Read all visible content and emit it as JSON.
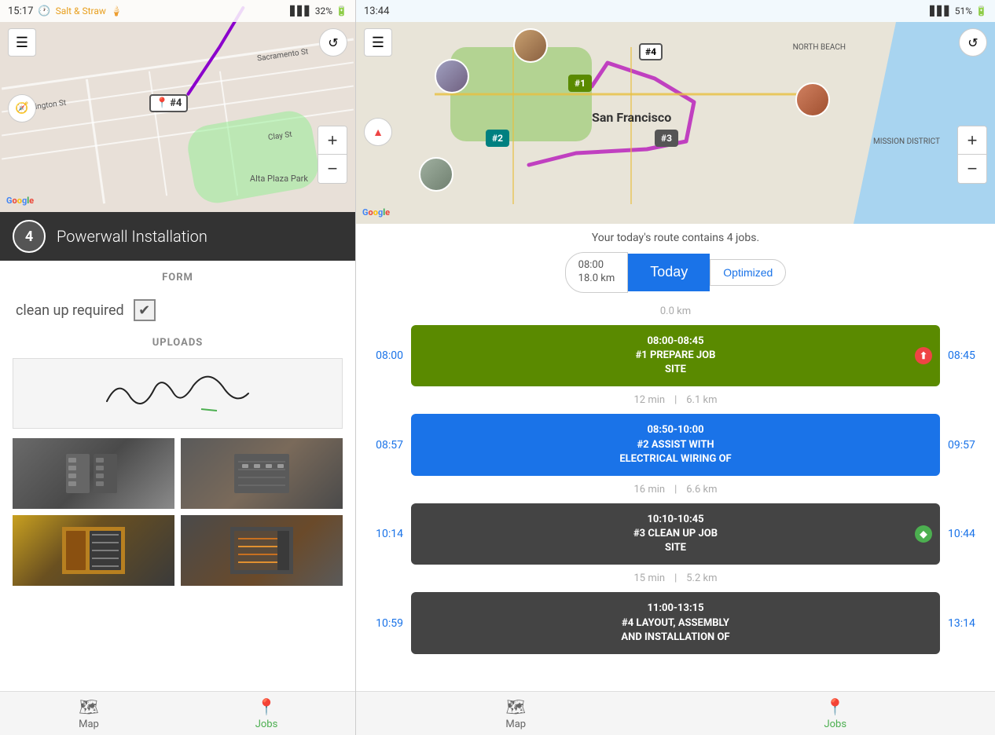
{
  "left": {
    "statusBar": {
      "time": "15:17",
      "battery": "32%",
      "appName": "Salt & Straw"
    },
    "map": {
      "parkName": "Alta Plaza Park",
      "streetNames": [
        "Sacramento St",
        "Washington St",
        "Clay St"
      ],
      "pinNumber": "#4",
      "googleLogo": [
        "G",
        "o",
        "o",
        "g",
        "l",
        "e"
      ]
    },
    "jobBar": {
      "number": "4",
      "title": "Powerwall Installation"
    },
    "formLabel": "FORM",
    "checkboxRow": {
      "label": "clean up required",
      "checked": true
    },
    "uploadsLabel": "UPLOADS",
    "signatureText": "James Miller",
    "bottomNav": {
      "map": {
        "label": "Map",
        "active": false
      },
      "jobs": {
        "label": "Jobs",
        "active": true
      }
    }
  },
  "right": {
    "statusBar": {
      "time": "13:44",
      "battery": "51%"
    },
    "map": {
      "city": "San Francisco",
      "district1": "NORTH BEACH",
      "district2": "MISSION DISTRICT",
      "googleLogo": [
        "G",
        "o",
        "o",
        "g",
        "l",
        "e"
      ],
      "pins": [
        {
          "id": "#1",
          "type": "green"
        },
        {
          "id": "#2",
          "type": "teal"
        },
        {
          "id": "#3",
          "type": "gray"
        },
        {
          "id": "#4",
          "type": "white"
        }
      ]
    },
    "routeInfo": "Your today's route contains 4 jobs.",
    "dateSelector": {
      "time": "08:00",
      "distance": "18.0 km",
      "todayLabel": "Today",
      "optimizedLabel": "Optimized"
    },
    "jobs": [
      {
        "id": 1,
        "timeStart": "08:00",
        "timeEnd": "08:45",
        "title": "08:00-08:45\n#1 PREPARE JOB\nSITE",
        "color": "green",
        "status": "urgent",
        "leftTime": "08:00",
        "rightTime": "08:45",
        "separator": {
          "before": "0.0 km"
        }
      },
      {
        "id": 2,
        "timeStart": "08:57",
        "timeEnd": "09:57",
        "title": "08:50-10:00\n#2 ASSIST WITH\nELECTRICAL WIRING OF",
        "color": "blue",
        "leftTime": "08:57",
        "rightTime": "09:57",
        "separator": {
          "before": "12 min | 6.1 km"
        }
      },
      {
        "id": 3,
        "timeStart": "10:14",
        "timeEnd": "10:44",
        "title": "10:10-10:45\n#3 CLEAN UP JOB\nSITE",
        "color": "dark",
        "status": "done",
        "leftTime": "10:14",
        "rightTime": "10:44",
        "separator": {
          "before": "16 min | 6.6 km"
        }
      },
      {
        "id": 4,
        "timeStart": "10:59",
        "timeEnd": "13:14",
        "title": "11:00-13:15\n#4 LAYOUT, ASSEMBLY\nAND INSTALLATION OF",
        "color": "dark",
        "leftTime": "10:59",
        "rightTime": "13:14",
        "separator": {
          "before": "15 min | 5.2 km"
        }
      }
    ],
    "bottomNav": {
      "map": {
        "label": "Map",
        "active": false
      },
      "jobs": {
        "label": "Jobs",
        "active": true
      }
    }
  }
}
